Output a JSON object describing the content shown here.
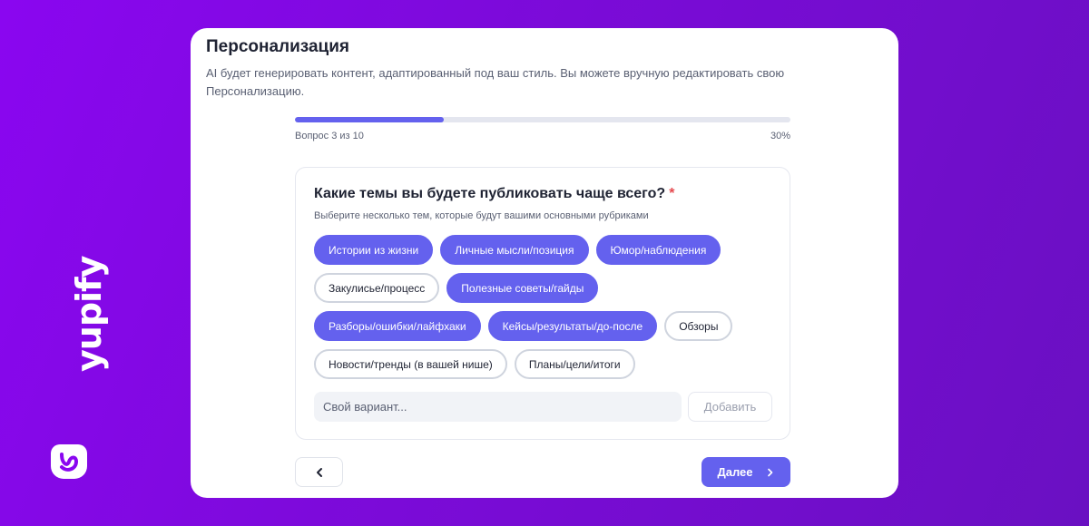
{
  "brand": {
    "name": "yupify"
  },
  "page": {
    "title": "Персонализация",
    "description": "AI будет генерировать контент, адаптированный под ваш стиль. Вы можете вручную редактировать свою Персонализацию."
  },
  "progress": {
    "label": "Вопрос 3 из 10",
    "percent_label": "30%",
    "fraction": 0.3
  },
  "question": {
    "title": "Какие темы вы будете публиковать чаще всего?",
    "required_mark": "*",
    "subtitle": "Выберите несколько тем, которые будут вашими основными рубриками",
    "options": [
      {
        "label": "Истории из жизни",
        "selected": true
      },
      {
        "label": "Личные мысли/позиция",
        "selected": true
      },
      {
        "label": "Юмор/наблюдения",
        "selected": true
      },
      {
        "label": "Закулисье/процесс",
        "selected": false
      },
      {
        "label": "Полезные советы/гайды",
        "selected": true
      },
      {
        "label": "Разборы/ошибки/лайфхаки",
        "selected": true
      },
      {
        "label": "Кейсы/результаты/до-после",
        "selected": true
      },
      {
        "label": "Обзоры",
        "selected": false
      },
      {
        "label": "Новости/тренды (в вашей нише)",
        "selected": false
      },
      {
        "label": "Планы/цели/итоги",
        "selected": false
      }
    ],
    "custom_placeholder": "Свой вариант...",
    "add_label": "Добавить"
  },
  "nav": {
    "back_icon": "chevron-left-icon",
    "next_label": "Далее",
    "next_icon": "chevron-right-icon"
  },
  "colors": {
    "accent": "#6461ee",
    "background": "#8a06f0",
    "required": "#e5484d"
  }
}
